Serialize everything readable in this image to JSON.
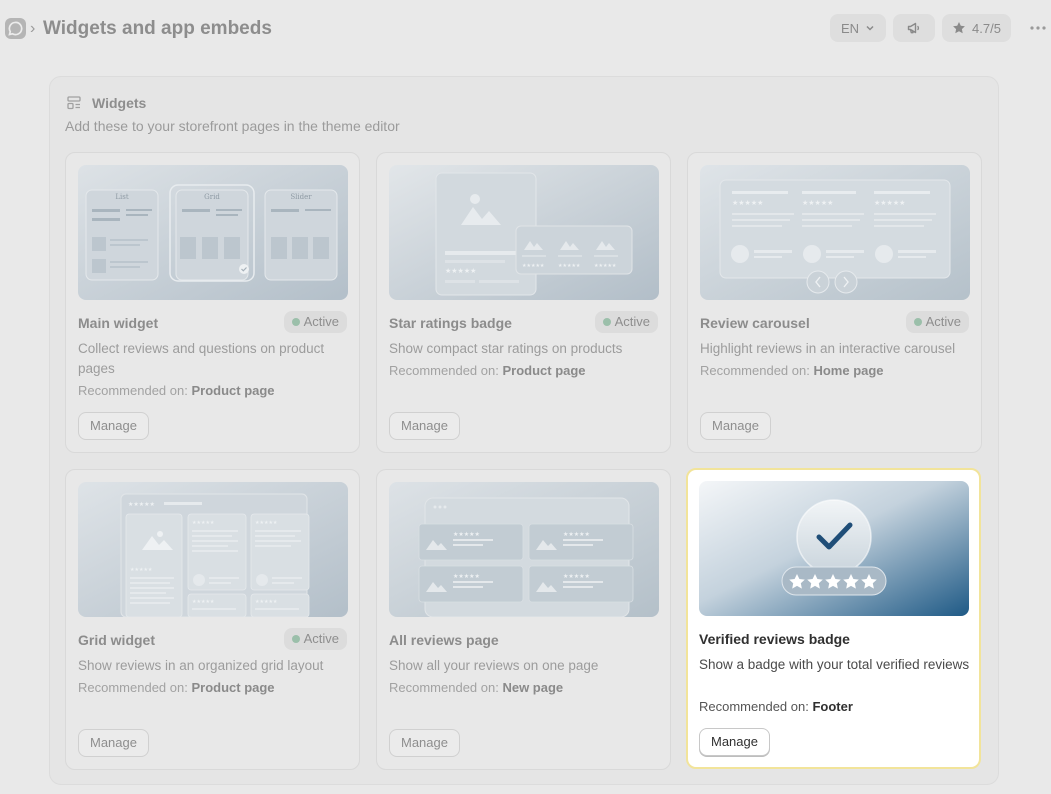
{
  "header": {
    "breadcrumb_separator": "›",
    "title": "Widgets and app embeds",
    "language": "EN",
    "rating": "4.7/5"
  },
  "panel": {
    "title": "Widgets",
    "subtitle": "Add these to your storefront pages in the theme editor"
  },
  "recommended_prefix": "Recommended on:",
  "manage_label": "Manage",
  "cards": [
    {
      "title": "Main widget",
      "status": "Active",
      "description": "Collect reviews and questions on product pages",
      "recommended_on": "Product page",
      "preview_labels": [
        "List",
        "Grid",
        "Slider"
      ]
    },
    {
      "title": "Star ratings badge",
      "status": "Active",
      "description": "Show compact star ratings on products",
      "recommended_on": "Product page"
    },
    {
      "title": "Review carousel",
      "status": "Active",
      "description": "Highlight reviews in an interactive carousel",
      "recommended_on": "Home page"
    },
    {
      "title": "Grid widget",
      "status": "Active",
      "description": "Show reviews in an organized grid layout",
      "recommended_on": "Product page"
    },
    {
      "title": "All reviews page",
      "status": "",
      "description": "Show all your reviews on one page",
      "recommended_on": "New page"
    },
    {
      "title": "Verified reviews badge",
      "status": "",
      "description": "Show a badge with your total verified reviews",
      "recommended_on": "Footer"
    }
  ],
  "colors": {
    "active_dot": "#9bbfaa",
    "highlight_border": "#f2e49a",
    "badge_gradient_dark": "#1f5a86"
  }
}
